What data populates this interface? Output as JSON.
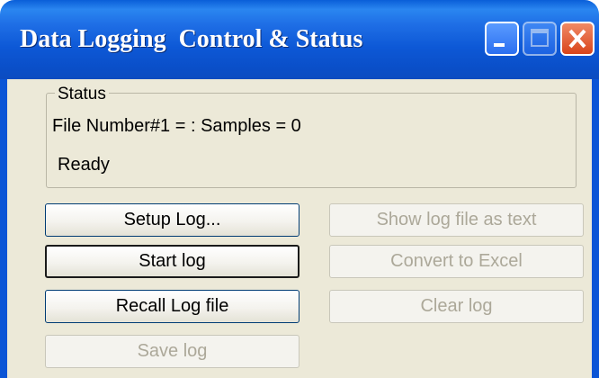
{
  "window": {
    "title": "Data Logging  Control & Status"
  },
  "status": {
    "group_label": "Status",
    "file_line": "File Number#1 = : Samples = 0",
    "state": "Ready"
  },
  "buttons": {
    "setup_log": "Setup Log...",
    "start_log": "Start log",
    "recall_log": "Recall Log file",
    "save_log": "Save log",
    "show_text": "Show log file as text",
    "convert_excel": "Convert to Excel",
    "clear_log": "Clear log"
  },
  "button_states": {
    "setup_log": "enabled",
    "start_log": "enabled (default)",
    "recall_log": "enabled",
    "save_log": "disabled",
    "show_text": "disabled",
    "convert_excel": "disabled",
    "clear_log": "disabled"
  },
  "colors": {
    "titlebar": "#0a4fc9",
    "client_bg": "#ece9d8",
    "disabled_text": "#aca899",
    "close_button": "#d9441a"
  },
  "icons": [
    "minimize-icon",
    "maximize-icon",
    "close-icon"
  ]
}
